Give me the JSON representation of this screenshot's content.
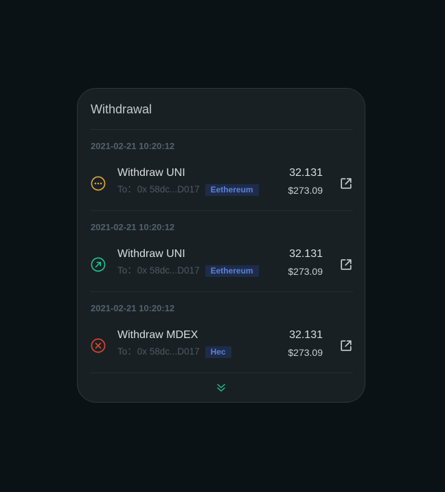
{
  "card": {
    "title": "Withdrawal",
    "accent_color": "#1fbf8f"
  },
  "transactions": [
    {
      "date": "2021-02-21 10:20:12",
      "status": "pending",
      "status_icon": "pending-dots-icon",
      "status_color": "#d9a53c",
      "title": "Withdraw UNI",
      "to_label": "To：",
      "to_address": "0x 58dc...D017",
      "chain": "Eethereum",
      "amount": "32.131",
      "usd_value": "$273.09",
      "link_icon": "external-link-icon"
    },
    {
      "date": "2021-02-21 10:20:12",
      "status": "success",
      "status_icon": "arrow-up-right-circle-icon",
      "status_color": "#1fbf8f",
      "title": "Withdraw UNI",
      "to_label": "To：",
      "to_address": "0x 58dc...D017",
      "chain": "Eethereum",
      "amount": "32.131",
      "usd_value": "$273.09",
      "link_icon": "external-link-icon"
    },
    {
      "date": "2021-02-21 10:20:12",
      "status": "failed",
      "status_icon": "x-circle-icon",
      "status_color": "#d8452d",
      "title": "Withdraw MDEX",
      "to_label": "To：",
      "to_address": "0x 58dc...D017",
      "chain": "Hec",
      "amount": "32.131",
      "usd_value": "$273.09",
      "link_icon": "external-link-icon"
    }
  ],
  "load_more_icon": "double-chevron-down-icon"
}
